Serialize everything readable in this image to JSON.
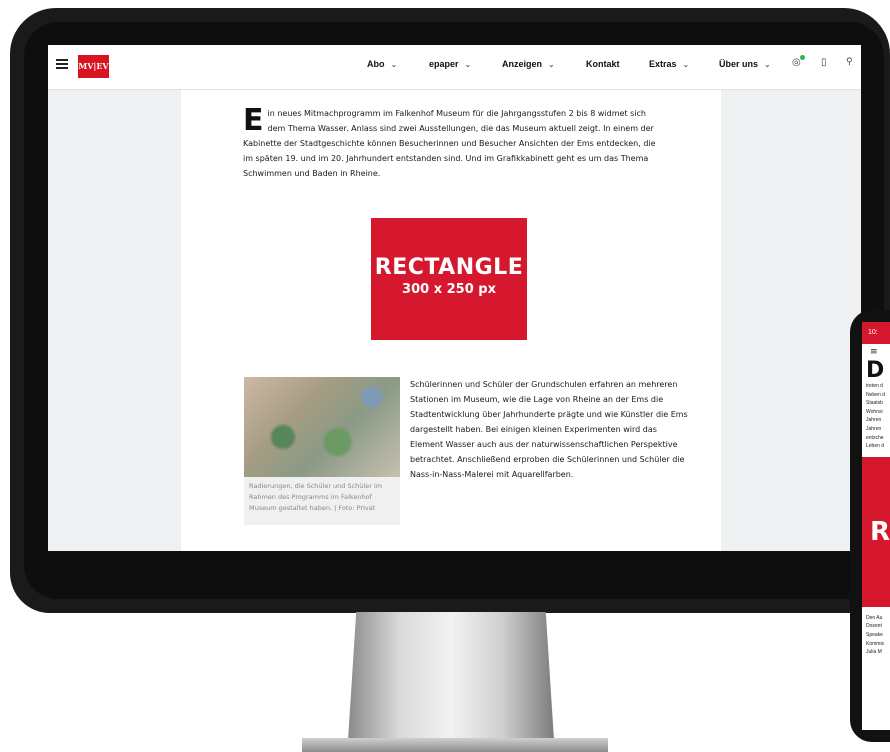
{
  "header": {
    "logo": "MV|EV",
    "nav": [
      "Abo",
      "epaper",
      "Anzeigen",
      "Kontakt",
      "Extras",
      "Über uns"
    ]
  },
  "article": {
    "dropcap": "E",
    "intro": "in neues Mitmachprogramm im Falkenhof Museum für die Jahrgangsstufen 2 bis 8 widmet sich dem Thema Wasser. Anlass sind zwei Ausstellungen, die das Museum aktuell zeigt. In einem der Kabinette der Stadtgeschichte können Besucherinnen und Besucher Ansichten der Ems entdecken, die im späten 19. und im 20. Jahrhundert entstanden sind. Und im Grafikkabinett geht es um das Thema Schwimmen und Baden in Rheine.",
    "ad_title": "RECTANGLE",
    "ad_size": "300 x 250 px",
    "caption": "Radierungen, die Schüler und Schüler im Rahmen des Programms im Falkenhof Museum gestaltet haben. | Foto: Privat",
    "body": "Schülerinnen und Schüler der Grundschulen erfahren an mehreren Stationen im Museum, wie die Lage von Rheine an der Ems die Stadtentwicklung über Jahrhunderte prägte und wie Künstler die Ems dargestellt haben. Bei einigen kleinen Experimenten wird das Element Wasser auch aus der naturwissenschaftlichen Perspektive betrachtet. Anschließend erproben die Schülerinnen und Schüler die Nass-in-Nass-Malerei mit Aquarellfarben."
  },
  "phone": {
    "time": "10:",
    "dropcap": "D",
    "lines": [
      "treten d",
      "Neben d",
      "Staatsb",
      "Wohnsi",
      "Jahren",
      "Jahren",
      "entsche",
      "Leben d"
    ],
    "ad_letter": "R",
    "lines2": [
      "Den Au",
      "Dozent",
      "Speake",
      "Kommis",
      "Julia M"
    ]
  }
}
